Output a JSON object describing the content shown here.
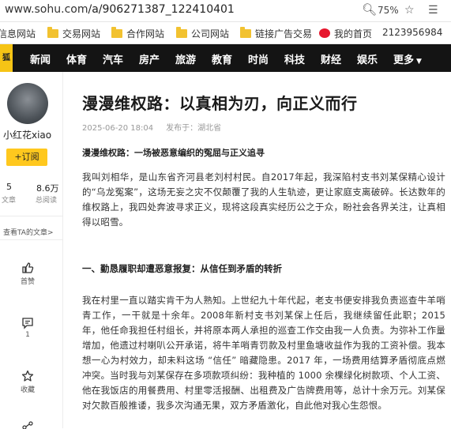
{
  "browser": {
    "url_domain": "www.sohu.com",
    "url_path": "/a/906271387_122410401",
    "zoom": "75%"
  },
  "bookmarks": [
    {
      "label": "信息网站",
      "icon": "folder-icon"
    },
    {
      "label": "交易网站",
      "icon": "folder-icon"
    },
    {
      "label": "合作网站",
      "icon": "folder-icon"
    },
    {
      "label": "公司网站",
      "icon": "folder-icon"
    },
    {
      "label": "链接广告交易",
      "icon": "folder-icon"
    },
    {
      "label": "我的首页",
      "icon": "weibo-icon"
    },
    {
      "label": "2123956984",
      "icon": ""
    }
  ],
  "nav": {
    "logo": "狐",
    "items": [
      "新闻",
      "体育",
      "汽车",
      "房产",
      "旅游",
      "教育",
      "时尚",
      "科技",
      "财经",
      "娱乐",
      "更多"
    ]
  },
  "author": {
    "name": "小红花xiao",
    "follow_label": "+订阅",
    "stats": [
      {
        "value": "5",
        "label": "文章"
      },
      {
        "value": "8.6万",
        "label": "总阅读"
      }
    ],
    "see_all": "查看TA的文章>"
  },
  "actions": [
    {
      "label": "首赞",
      "icon": "thumbs-up-icon"
    },
    {
      "label": "1",
      "icon": "comment-icon"
    },
    {
      "label": "收藏",
      "icon": "star-icon"
    }
  ],
  "article": {
    "title": "漫漫维权路：以真相为刃，向正义而行",
    "date": "2025-06-20 18:04",
    "from": "发布于：湖北省",
    "subtitle": "漫漫维权路：一场被恶意编织的冤屈与正义追寻",
    "intro": "我叫刘相华，是山东省齐河县老刘村村民。自2017年起，我深陷村支书刘某保精心设计的“乌龙冤案”，这场无妄之灾不仅颠覆了我的人生轨迹，更让家庭支离破碎。长达数年的维权路上，我四处奔波寻求正义，现将这段真实经历公之于众，盼社会各界关注，让真相得以昭雪。",
    "section1_title": "一、勤恳履职却遭恶意报复：从信任到矛盾的转折",
    "section1_body": "我在村里一直以踏实肯干为人熟知。上世纪九十年代起，老支书便安排我负责巡查牛羊哨青工作，一干就是十余年。2008年新村支书刘某保上任后，我继续留任此职；2015 年，他任命我担任村组长，并将原本两人承担的巡查工作交由我一人负责。为弥补工作量增加，他遗过村喇叭公开承诺，将牛羊哨青罚款及村里鱼塘收益作为我的工资补偿。我本想一心为村效力，却未料这场 “信任” 暗藏隐患。2017 年，一场费用结算矛盾彻底点燃冲突。当时我与刘某保存在多项款项纠纷：我种植的 1000 余棵绿化树款项、个人工资、他在我饭店的用餐费用、村里零活报酬、出租费及广告牌费用等，总计十余万元。刘某保对欠款百般推诿，我多次沟通无果，双方矛盾激化，自此他对我心生怨恨。"
  }
}
